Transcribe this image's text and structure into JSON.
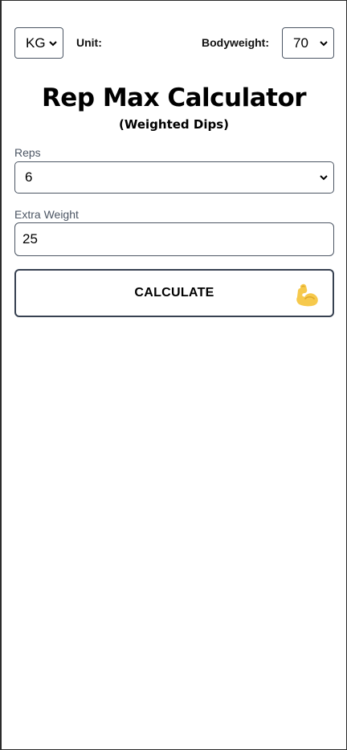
{
  "header": {
    "unit_value": "KG",
    "unit_label": "Unit:",
    "bodyweight_label": "Bodyweight:",
    "bodyweight_value": "70"
  },
  "title": "Rep Max Calculator",
  "subtitle": "(Weighted Dips)",
  "form": {
    "reps_label": "Reps",
    "reps_value": "6",
    "extra_weight_label": "Extra Weight",
    "extra_weight_value": "25"
  },
  "button": {
    "label": "CALCULATE",
    "icon": "flexed-biceps-icon"
  },
  "colors": {
    "border": "#4b5563",
    "button_border": "#374151",
    "label_gray": "#4b5563",
    "icon_yellow": "#f6c94c"
  }
}
